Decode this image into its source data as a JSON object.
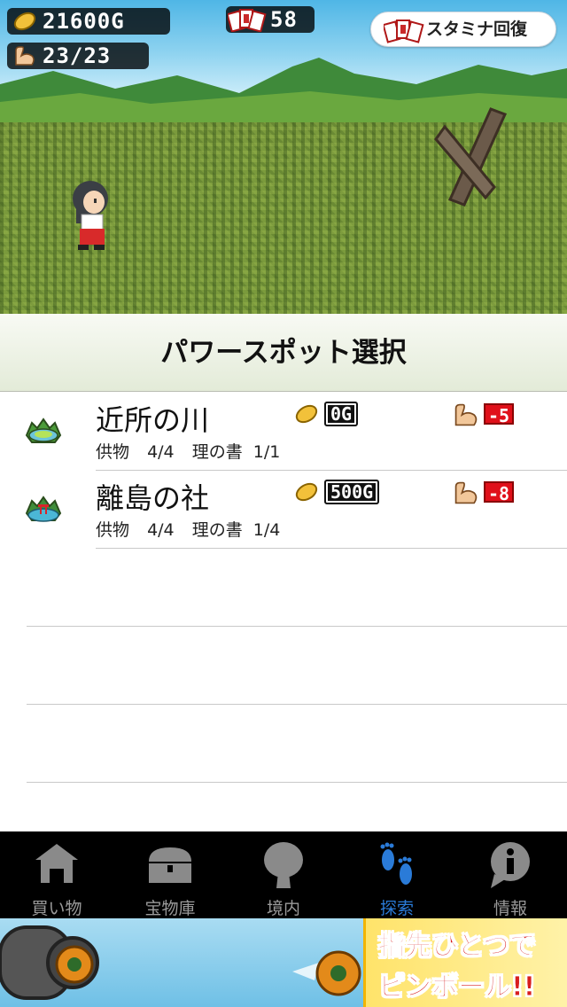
{
  "hud": {
    "gold": "21600G",
    "stamina": "23/23",
    "cards": "58",
    "stamina_recover_label": "スタミナ回復"
  },
  "header": {
    "title": "パワースポット選択"
  },
  "spots": [
    {
      "name": "近所の川",
      "offering": "供物",
      "offering_count": "4/4",
      "book": "理の書",
      "book_count": "1/1",
      "cost": "0G",
      "stamina_cost": "-5"
    },
    {
      "name": "離島の社",
      "offering": "供物",
      "offering_count": "4/4",
      "book": "理の書",
      "book_count": "1/4",
      "cost": "500G",
      "stamina_cost": "-8"
    }
  ],
  "tabs": [
    {
      "label": "買い物",
      "icon": "shop-icon"
    },
    {
      "label": "宝物庫",
      "icon": "treasure-chest-icon"
    },
    {
      "label": "境内",
      "icon": "tree-icon"
    },
    {
      "label": "探索",
      "icon": "footprints-icon",
      "active": true
    },
    {
      "label": "情報",
      "icon": "info-icon"
    }
  ],
  "ad": {
    "line1": "指先ひとつで",
    "line2": "ピンボール!!"
  },
  "colors": {
    "tab_active": "#2a7bd8",
    "tab_inactive": "#9a9a9a",
    "stamina_cost_bg": "#e0101a"
  }
}
